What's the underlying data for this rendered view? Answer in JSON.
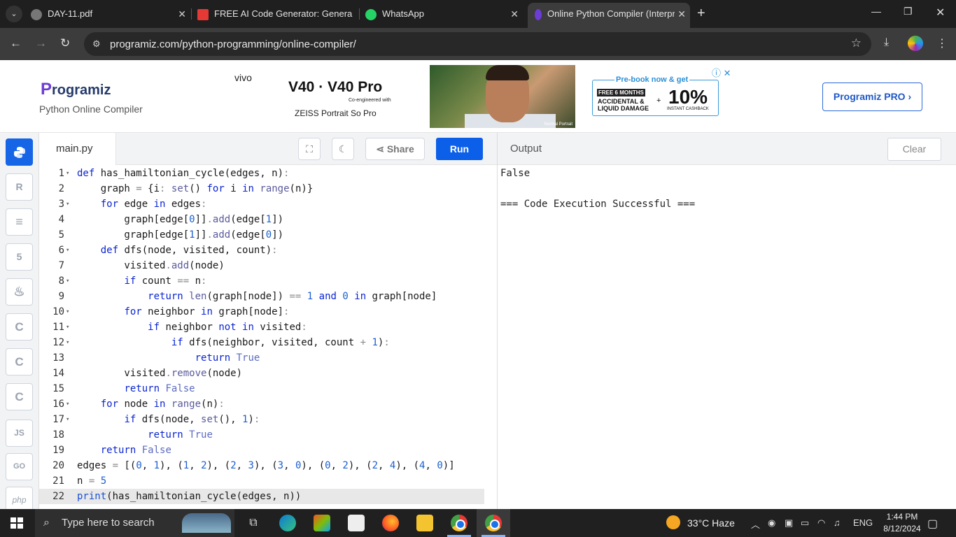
{
  "browser": {
    "tabs": [
      {
        "title": "DAY-11.pdf",
        "active": false
      },
      {
        "title": "FREE AI Code Generator: Genera",
        "active": false
      },
      {
        "title": "WhatsApp",
        "active": false
      },
      {
        "title": "Online Python Compiler (Interpr",
        "active": true
      }
    ],
    "url": "programiz.com/python-programming/online-compiler/"
  },
  "site": {
    "logo": "rogramiz",
    "logo_letter": "P",
    "subtitle": "Python Online Compiler",
    "pro_button": "Programiz PRO ›"
  },
  "ad": {
    "brand": "vivo",
    "product": "V40 · V40 Pro",
    "coengineered": "Co-engineered with",
    "tagline": "ZEISS Portrait So Pro",
    "photo_caption": "Normal Portrait",
    "prebook": "Pre-book now & get",
    "free_months": "FREE 6 MONTHS",
    "accidental": "ACCIDENTAL &",
    "liquid": "LIQUID DAMAGE",
    "plus": "+",
    "flat_pct": "10%",
    "cashback": "INSTANT CASHBACK"
  },
  "sidebar": {
    "items": [
      {
        "label": "",
        "name": "python"
      },
      {
        "label": "R",
        "name": "r"
      },
      {
        "label": "≡",
        "name": "sql"
      },
      {
        "label": "5",
        "name": "html"
      },
      {
        "label": "♨",
        "name": "java"
      },
      {
        "label": "C",
        "name": "c"
      },
      {
        "label": "C",
        "name": "cpp"
      },
      {
        "label": "C",
        "name": "csharp"
      },
      {
        "label": "JS",
        "name": "js"
      },
      {
        "label": "GO",
        "name": "go"
      },
      {
        "label": "php",
        "name": "php"
      }
    ]
  },
  "editor": {
    "filename": "main.py",
    "share_label": "Share",
    "run_label": "Run",
    "lines": [
      {
        "n": "1",
        "fold": true
      },
      {
        "n": "2",
        "fold": false
      },
      {
        "n": "3",
        "fold": true
      },
      {
        "n": "4",
        "fold": false
      },
      {
        "n": "5",
        "fold": false
      },
      {
        "n": "6",
        "fold": true
      },
      {
        "n": "7",
        "fold": false
      },
      {
        "n": "8",
        "fold": true
      },
      {
        "n": "9",
        "fold": false
      },
      {
        "n": "10",
        "fold": true
      },
      {
        "n": "11",
        "fold": true
      },
      {
        "n": "12",
        "fold": true
      },
      {
        "n": "13",
        "fold": false
      },
      {
        "n": "14",
        "fold": false
      },
      {
        "n": "15",
        "fold": false
      },
      {
        "n": "16",
        "fold": true
      },
      {
        "n": "17",
        "fold": true
      },
      {
        "n": "18",
        "fold": false
      },
      {
        "n": "19",
        "fold": false
      },
      {
        "n": "20",
        "fold": false
      },
      {
        "n": "21",
        "fold": false
      },
      {
        "n": "22",
        "fold": false
      }
    ],
    "code": [
      "def has_hamiltonian_cycle(edges, n):",
      "    graph = {i: set() for i in range(n)}",
      "    for edge in edges:",
      "        graph[edge[0]].add(edge[1])",
      "        graph[edge[1]].add(edge[0])",
      "    def dfs(node, visited, count):",
      "        visited.add(node)",
      "        if count == n:",
      "            return len(graph[node]) == 1 and 0 in graph[node]",
      "        for neighbor in graph[node]:",
      "            if neighbor not in visited:",
      "                if dfs(neighbor, visited, count + 1):",
      "                    return True",
      "        visited.remove(node)",
      "        return False",
      "    for node in range(n):",
      "        if dfs(node, set(), 1):",
      "            return True",
      "    return False",
      "edges = [(0, 1), (1, 2), (2, 3), (3, 0), (0, 2), (2, 4), (4, 0)]",
      "n = 5",
      "print(has_hamiltonian_cycle(edges, n))"
    ]
  },
  "output": {
    "title": "Output",
    "clear_label": "Clear",
    "lines": [
      "False",
      "",
      "=== Code Execution Successful ==="
    ]
  },
  "taskbar": {
    "search_placeholder": "Type here to search",
    "weather": "33°C  Haze",
    "lang": "ENG",
    "time": "1:44 PM",
    "date": "8/12/2024"
  },
  "colors": {
    "run": "#0c5fe8",
    "keyword": "#0b25d1",
    "accent": "#1565e6"
  }
}
